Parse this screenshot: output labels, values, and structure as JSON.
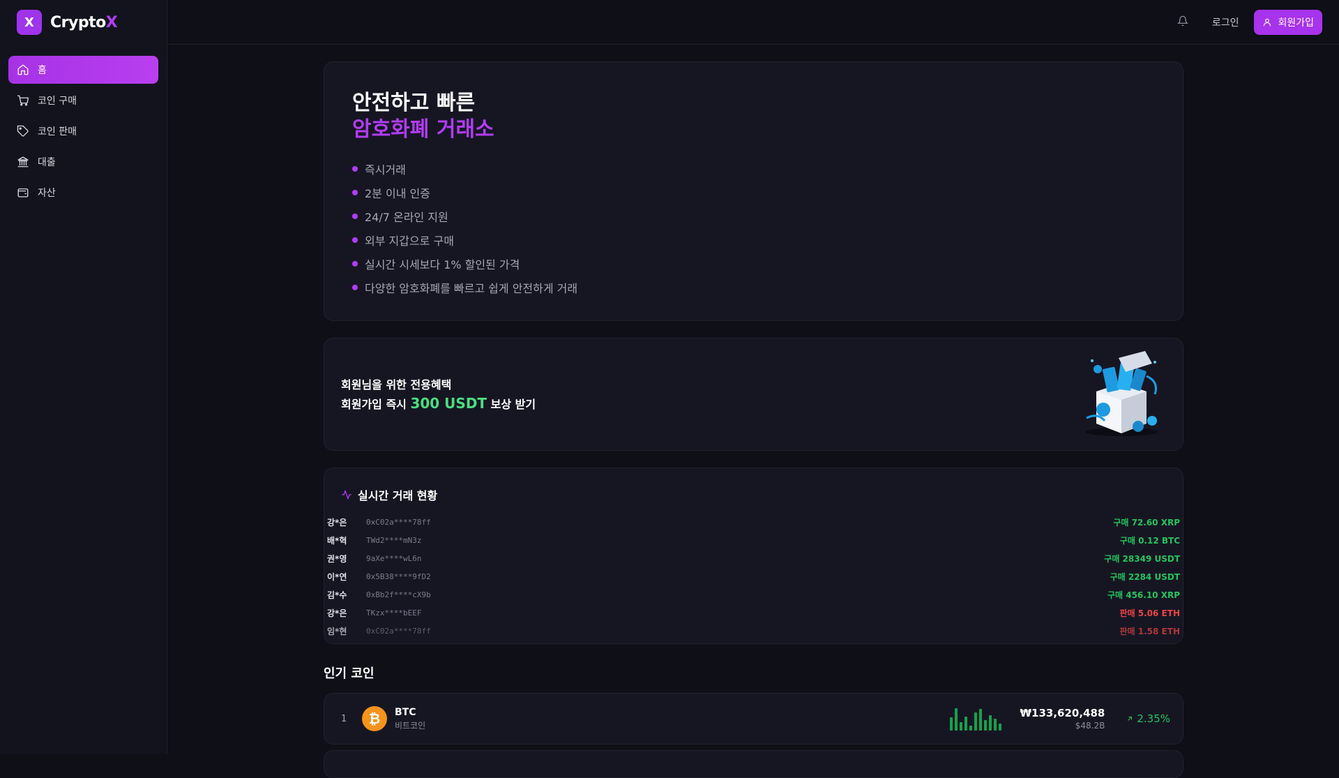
{
  "brand": {
    "logo_letter": "X",
    "name_main": "Crypto",
    "name_accent": "X"
  },
  "sidebar": {
    "items": [
      {
        "label": "홈",
        "icon": "home-icon",
        "active": true
      },
      {
        "label": "코인 구매",
        "icon": "cart-icon"
      },
      {
        "label": "코인 판매",
        "icon": "tag-icon"
      },
      {
        "label": "대출",
        "icon": "bank-icon"
      },
      {
        "label": "자산",
        "icon": "wallet-icon"
      }
    ]
  },
  "header": {
    "login_label": "로그인",
    "signup_label": "회원가입"
  },
  "hero": {
    "title_line1": "안전하고 빠른",
    "title_line2": "암호화폐 거래소",
    "features": [
      "즉시거래",
      "2분 이내 인증",
      "24/7 온라인 지원",
      "외부 지갑으로 구매",
      "실시간 시세보다 1% 할인된 가격",
      "다양한 암호화폐를 빠르고 쉽게 안전하게 거래"
    ]
  },
  "promo": {
    "line1": "회원님을 위한 전용혜택",
    "line2_prefix": "회원가입 즉시",
    "line2_highlight": "300 USDT",
    "line2_suffix": "보상 받기"
  },
  "live_trades": {
    "title": "실시간 거래 현황",
    "rows": [
      {
        "name": "강*은",
        "address": "0xC02a****78ff",
        "action": "구매 72.60 XRP",
        "type": "buy"
      },
      {
        "name": "배*혁",
        "address": "TWd2****mN3z",
        "action": "구매 0.12 BTC",
        "type": "buy"
      },
      {
        "name": "권*영",
        "address": "9aXe****wL6n",
        "action": "구매 28349 USDT",
        "type": "buy"
      },
      {
        "name": "이*연",
        "address": "0x5B38****9fD2",
        "action": "구매 2284 USDT",
        "type": "buy"
      },
      {
        "name": "김*수",
        "address": "0xBb2f****cX9b",
        "action": "구매 456.10 XRP",
        "type": "buy"
      },
      {
        "name": "강*은",
        "address": "TKzx****bEEF",
        "action": "판매 5.06 ETH",
        "type": "sell"
      },
      {
        "name": "임*현",
        "address": "0xC02a****78ff",
        "action": "판매 1.58 ETH",
        "type": "sell"
      }
    ]
  },
  "popular": {
    "title": "인기 코인",
    "coins": [
      {
        "rank": "1",
        "symbol": "BTC",
        "name_kr": "비트코인",
        "icon_glyph": "₿",
        "price": "₩133,620,488",
        "market_cap": "$48.2B",
        "change": "2.35%",
        "sparkline": [
          0.55,
          0.95,
          0.35,
          0.6,
          0.2,
          0.75,
          0.9,
          0.45,
          0.65,
          0.5,
          0.3
        ]
      }
    ]
  },
  "colors": {
    "accent": "#b23cf5",
    "buy": "#22c55e",
    "sell": "#ef4444",
    "highlight": "#4ade80"
  }
}
